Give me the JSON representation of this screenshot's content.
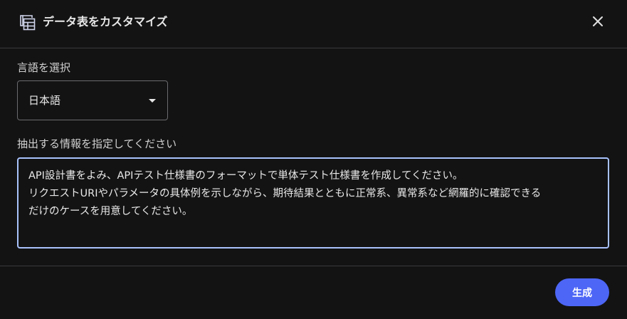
{
  "dialog": {
    "title": "データ表をカスタマイズ",
    "icon": "table-view-icon",
    "close_icon": "close-icon"
  },
  "language": {
    "label": "言語を選択",
    "selected": "日本語"
  },
  "extraction": {
    "label": "抽出する情報を指定してください",
    "value": "API設計書をよみ、APIテスト仕様書のフォーマットで単体テスト仕様書を作成してください。\nリクエストURIやパラメータの具体例を示しながら、期待結果とともに正常系、異常系など網羅的に確認できる\nだけのケースを用意してください。"
  },
  "footer": {
    "generate_label": "生成"
  },
  "colors": {
    "background": "#131314",
    "accent": "#4d66f6",
    "focus_border": "#a8c2fb"
  }
}
